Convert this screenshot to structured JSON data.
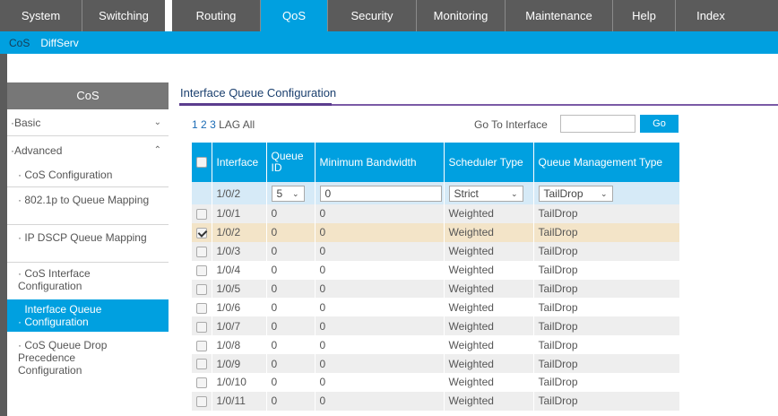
{
  "topnav": {
    "tabs": [
      "System",
      "Switching",
      "Routing",
      "QoS",
      "Security",
      "Monitoring",
      "Maintenance",
      "Help",
      "Index"
    ],
    "active": "QoS"
  },
  "subnav": {
    "items": [
      "CoS",
      "DiffServ"
    ]
  },
  "sidebar": {
    "header": "CoS",
    "basic": "Basic",
    "advanced": "Advanced",
    "items": [
      "CoS Configuration",
      "802.1p to Queue Mapping",
      "IP DSCP Queue Mapping",
      "CoS Interface Configuration",
      "Interface Queue Configuration",
      "CoS Queue Drop Precedence Configuration"
    ]
  },
  "content": {
    "title": "Interface Queue Configuration",
    "pages": [
      "1",
      "2",
      "3",
      "LAG",
      "All"
    ],
    "goto_label": "Go To Interface",
    "goto_value": "",
    "go_button": "Go"
  },
  "table": {
    "headers": {
      "interface": "Interface",
      "queue_id": "Queue ID",
      "min_bw": "Minimum Bandwidth",
      "scheduler": "Scheduler Type",
      "qmgmt": "Queue Management Type"
    },
    "edit_row": {
      "interface": "1/0/2",
      "queue_id": "5",
      "min_bw": "0",
      "scheduler": "Strict",
      "qmgmt": "TailDrop"
    },
    "rows": [
      {
        "interface": "1/0/1",
        "queue_id": "0",
        "min_bw": "0",
        "scheduler": "Weighted",
        "qmgmt": "TailDrop",
        "checked": false
      },
      {
        "interface": "1/0/2",
        "queue_id": "0",
        "min_bw": "0",
        "scheduler": "Weighted",
        "qmgmt": "TailDrop",
        "checked": true
      },
      {
        "interface": "1/0/3",
        "queue_id": "0",
        "min_bw": "0",
        "scheduler": "Weighted",
        "qmgmt": "TailDrop",
        "checked": false
      },
      {
        "interface": "1/0/4",
        "queue_id": "0",
        "min_bw": "0",
        "scheduler": "Weighted",
        "qmgmt": "TailDrop",
        "checked": false
      },
      {
        "interface": "1/0/5",
        "queue_id": "0",
        "min_bw": "0",
        "scheduler": "Weighted",
        "qmgmt": "TailDrop",
        "checked": false
      },
      {
        "interface": "1/0/6",
        "queue_id": "0",
        "min_bw": "0",
        "scheduler": "Weighted",
        "qmgmt": "TailDrop",
        "checked": false
      },
      {
        "interface": "1/0/7",
        "queue_id": "0",
        "min_bw": "0",
        "scheduler": "Weighted",
        "qmgmt": "TailDrop",
        "checked": false
      },
      {
        "interface": "1/0/8",
        "queue_id": "0",
        "min_bw": "0",
        "scheduler": "Weighted",
        "qmgmt": "TailDrop",
        "checked": false
      },
      {
        "interface": "1/0/9",
        "queue_id": "0",
        "min_bw": "0",
        "scheduler": "Weighted",
        "qmgmt": "TailDrop",
        "checked": false
      },
      {
        "interface": "1/0/10",
        "queue_id": "0",
        "min_bw": "0",
        "scheduler": "Weighted",
        "qmgmt": "TailDrop",
        "checked": false
      },
      {
        "interface": "1/0/11",
        "queue_id": "0",
        "min_bw": "0",
        "scheduler": "Weighted",
        "qmgmt": "TailDrop",
        "checked": false
      }
    ]
  },
  "colors": {
    "accent": "#00a0e0",
    "nav": "#5b5b5b",
    "selected_row": "#f3e4c8"
  }
}
